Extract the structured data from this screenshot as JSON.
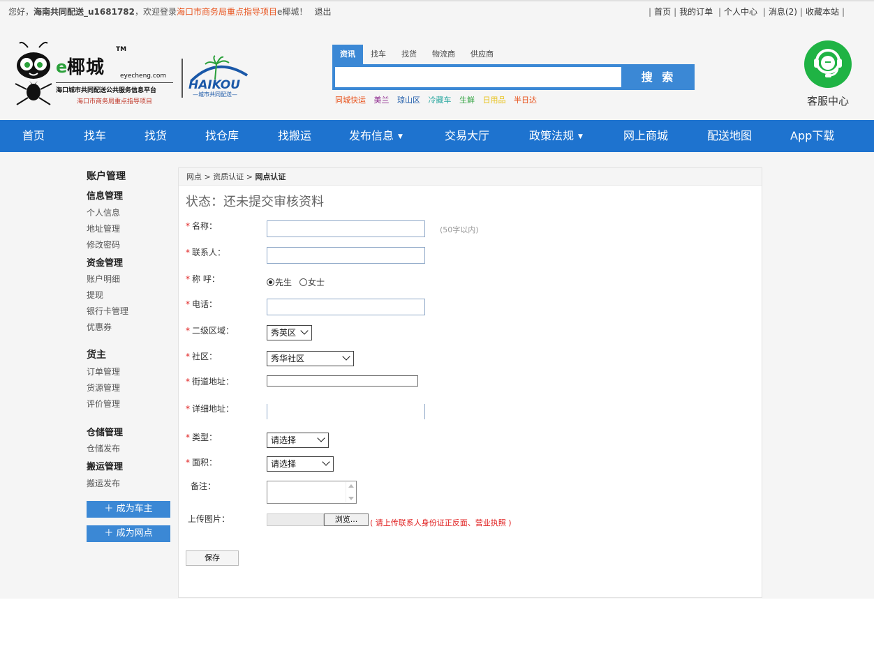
{
  "topbar": {
    "greeting": "您好，",
    "username": "海南共同配送_u1681782",
    "welcome_pre": "，欢迎登录",
    "org": "海口市商务局重点指导项目",
    "welcome_post": "e椰城！",
    "logout": "退出",
    "links": [
      "首页",
      "我的订单",
      "个人中心",
      "消息(2)",
      "收藏本站"
    ]
  },
  "logo": {
    "e": "e",
    "name": "椰城",
    "tm": "TM",
    "domain": "eyecheng.com",
    "subtitle": "海口城市共同配送公共服务信息平台",
    "subtitle2": "海口市商务局重点指导项目",
    "partner": "HAIKOU",
    "partner_sub": "—城市共同配送—"
  },
  "search": {
    "tabs": [
      "资讯",
      "找车",
      "找货",
      "物流商",
      "供应商"
    ],
    "active_tab": "资讯",
    "button": "搜 索",
    "hot": [
      {
        "label": "同城快运",
        "color": "#e8531d"
      },
      {
        "label": "美兰",
        "color": "#8e2a8e"
      },
      {
        "label": "琼山区",
        "color": "#1a58a8"
      },
      {
        "label": "冷藏车",
        "color": "#2aa8a0"
      },
      {
        "label": "生鲜",
        "color": "#2aa03a"
      },
      {
        "label": "日用品",
        "color": "#e8c21d"
      },
      {
        "label": "半日达",
        "color": "#e8531d"
      }
    ]
  },
  "service": {
    "label": "客服中心",
    "color": "#1fb344"
  },
  "nav": {
    "items": [
      "首页",
      "找车",
      "找货",
      "找仓库",
      "找搬运",
      "发布信息",
      "交易大厅",
      "政策法规",
      "网上商城",
      "配送地图",
      "App下载"
    ]
  },
  "sidebar": {
    "title": "账户管理",
    "info_mgmt": "信息管理",
    "info_items": [
      "个人信息",
      "地址管理",
      "修改密码"
    ],
    "fund_mgmt": "资金管理",
    "fund_items": [
      "账户明细",
      "提现",
      "银行卡管理",
      "优惠券"
    ],
    "shipper": "货主",
    "shipper_items": [
      "订单管理",
      "货源管理",
      "评价管理"
    ],
    "storage_mgmt": "仓储管理",
    "storage_items": [
      "仓储发布"
    ],
    "moving_mgmt": "搬运管理",
    "moving_items": [
      "搬运发布"
    ],
    "btn_driver": "成为车主",
    "btn_outlet": "成为网点"
  },
  "breadcrumb": {
    "items": [
      "网点",
      "资质认证",
      "网点认证"
    ],
    "sep": ">"
  },
  "status": "状态：还未提交审核资料",
  "form": {
    "name_label": "名称：",
    "name_hint": "(50字以内)",
    "contact_label": "联系人：",
    "salutation_label": "称 呼：",
    "salutation_options": [
      "先生",
      "女士"
    ],
    "phone_label": "电话：",
    "region_label": "二级区域：",
    "region_value": "秀英区",
    "community_label": "社区：",
    "community_value": "秀华社区",
    "street_label": "街道地址：",
    "detail_label": "详细地址：",
    "type_label": "类型：",
    "type_value": "请选择",
    "area_label": "面积：",
    "area_value": "请选择",
    "remark_label": "备注：",
    "upload_label": "上传图片：",
    "browse": "浏览...",
    "upload_hint": "( 请上传联系人身份证正反面、营业执照 )",
    "save": "保存"
  }
}
